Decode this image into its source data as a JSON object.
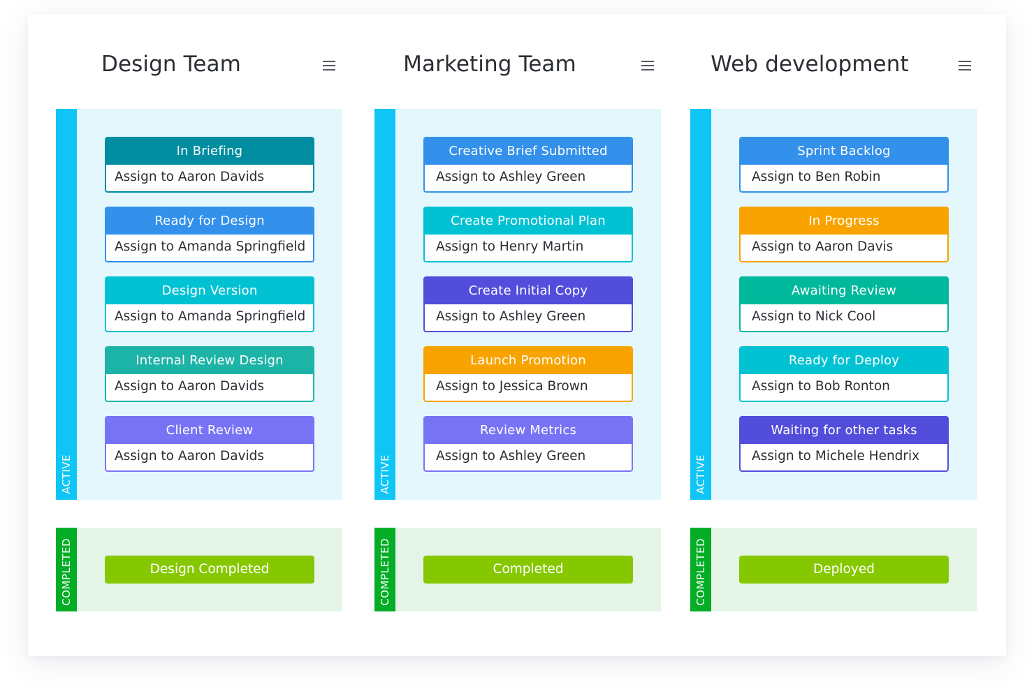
{
  "columns": [
    {
      "title": "Design Team",
      "menu_icon": "hamburger-menu-icon",
      "active_label": "ACTIVE",
      "completed_label": "COMPLETED",
      "cards": [
        {
          "status": "In Briefing",
          "assignee": "Assign to Aaron Davids",
          "color": "#008da0"
        },
        {
          "status": "Ready for Design",
          "assignee": "Assign to Amanda Springfield",
          "color": "#3390eb"
        },
        {
          "status": "Design Version",
          "assignee": "Assign to Amanda Springfield",
          "color": "#00c2d3"
        },
        {
          "status": "Internal Review Design",
          "assignee": "Assign to Aaron Davids",
          "color": "#1cb4a6"
        },
        {
          "status": "Client Review",
          "assignee": "Assign to Aaron Davids",
          "color": "#7873f5"
        }
      ],
      "completed_button": {
        "label": "Design Completed",
        "color": "#86c800"
      }
    },
    {
      "title": "Marketing Team",
      "menu_icon": "hamburger-menu-icon",
      "active_label": "ACTIVE",
      "completed_label": "COMPLETED",
      "cards": [
        {
          "status": "Creative Brief Submitted",
          "assignee": "Assign to Ashley Green",
          "color": "#3390eb"
        },
        {
          "status": "Create Promotional Plan",
          "assignee": "Assign to Henry Martin",
          "color": "#00c2d3"
        },
        {
          "status": "Create Initial Copy",
          "assignee": "Assign to Ashley Green",
          "color": "#524ddb"
        },
        {
          "status": "Launch Promotion",
          "assignee": "Assign to Jessica Brown",
          "color": "#f8a300"
        },
        {
          "status": "Review Metrics",
          "assignee": "Assign to Ashley Green",
          "color": "#7873f5"
        }
      ],
      "completed_button": {
        "label": "Completed",
        "color": "#86c800"
      }
    },
    {
      "title": "Web development",
      "menu_icon": "hamburger-menu-icon",
      "active_label": "ACTIVE",
      "completed_label": "COMPLETED",
      "cards": [
        {
          "status": "Sprint Backlog",
          "assignee": "Assign to Ben Robin",
          "color": "#3390eb"
        },
        {
          "status": "In Progress",
          "assignee": "Assign to Aaron Davis",
          "color": "#f8a300"
        },
        {
          "status": "Awaiting Review",
          "assignee": "Assign to Nick Cool",
          "color": "#00b89c"
        },
        {
          "status": "Ready for Deploy",
          "assignee": "Assign to Bob Ronton",
          "color": "#00c2d3"
        },
        {
          "status": "Waiting for other tasks",
          "assignee": "Assign to Michele Hendrix",
          "color": "#524ddb"
        }
      ],
      "completed_button": {
        "label": "Deployed",
        "color": "#86c800"
      }
    }
  ],
  "colors": {
    "active_strip": "#0ec5f5",
    "active_lane_bg": "#e3f7fd",
    "completed_strip": "#03ad25",
    "completed_lane_bg": "#e4f5e8"
  }
}
